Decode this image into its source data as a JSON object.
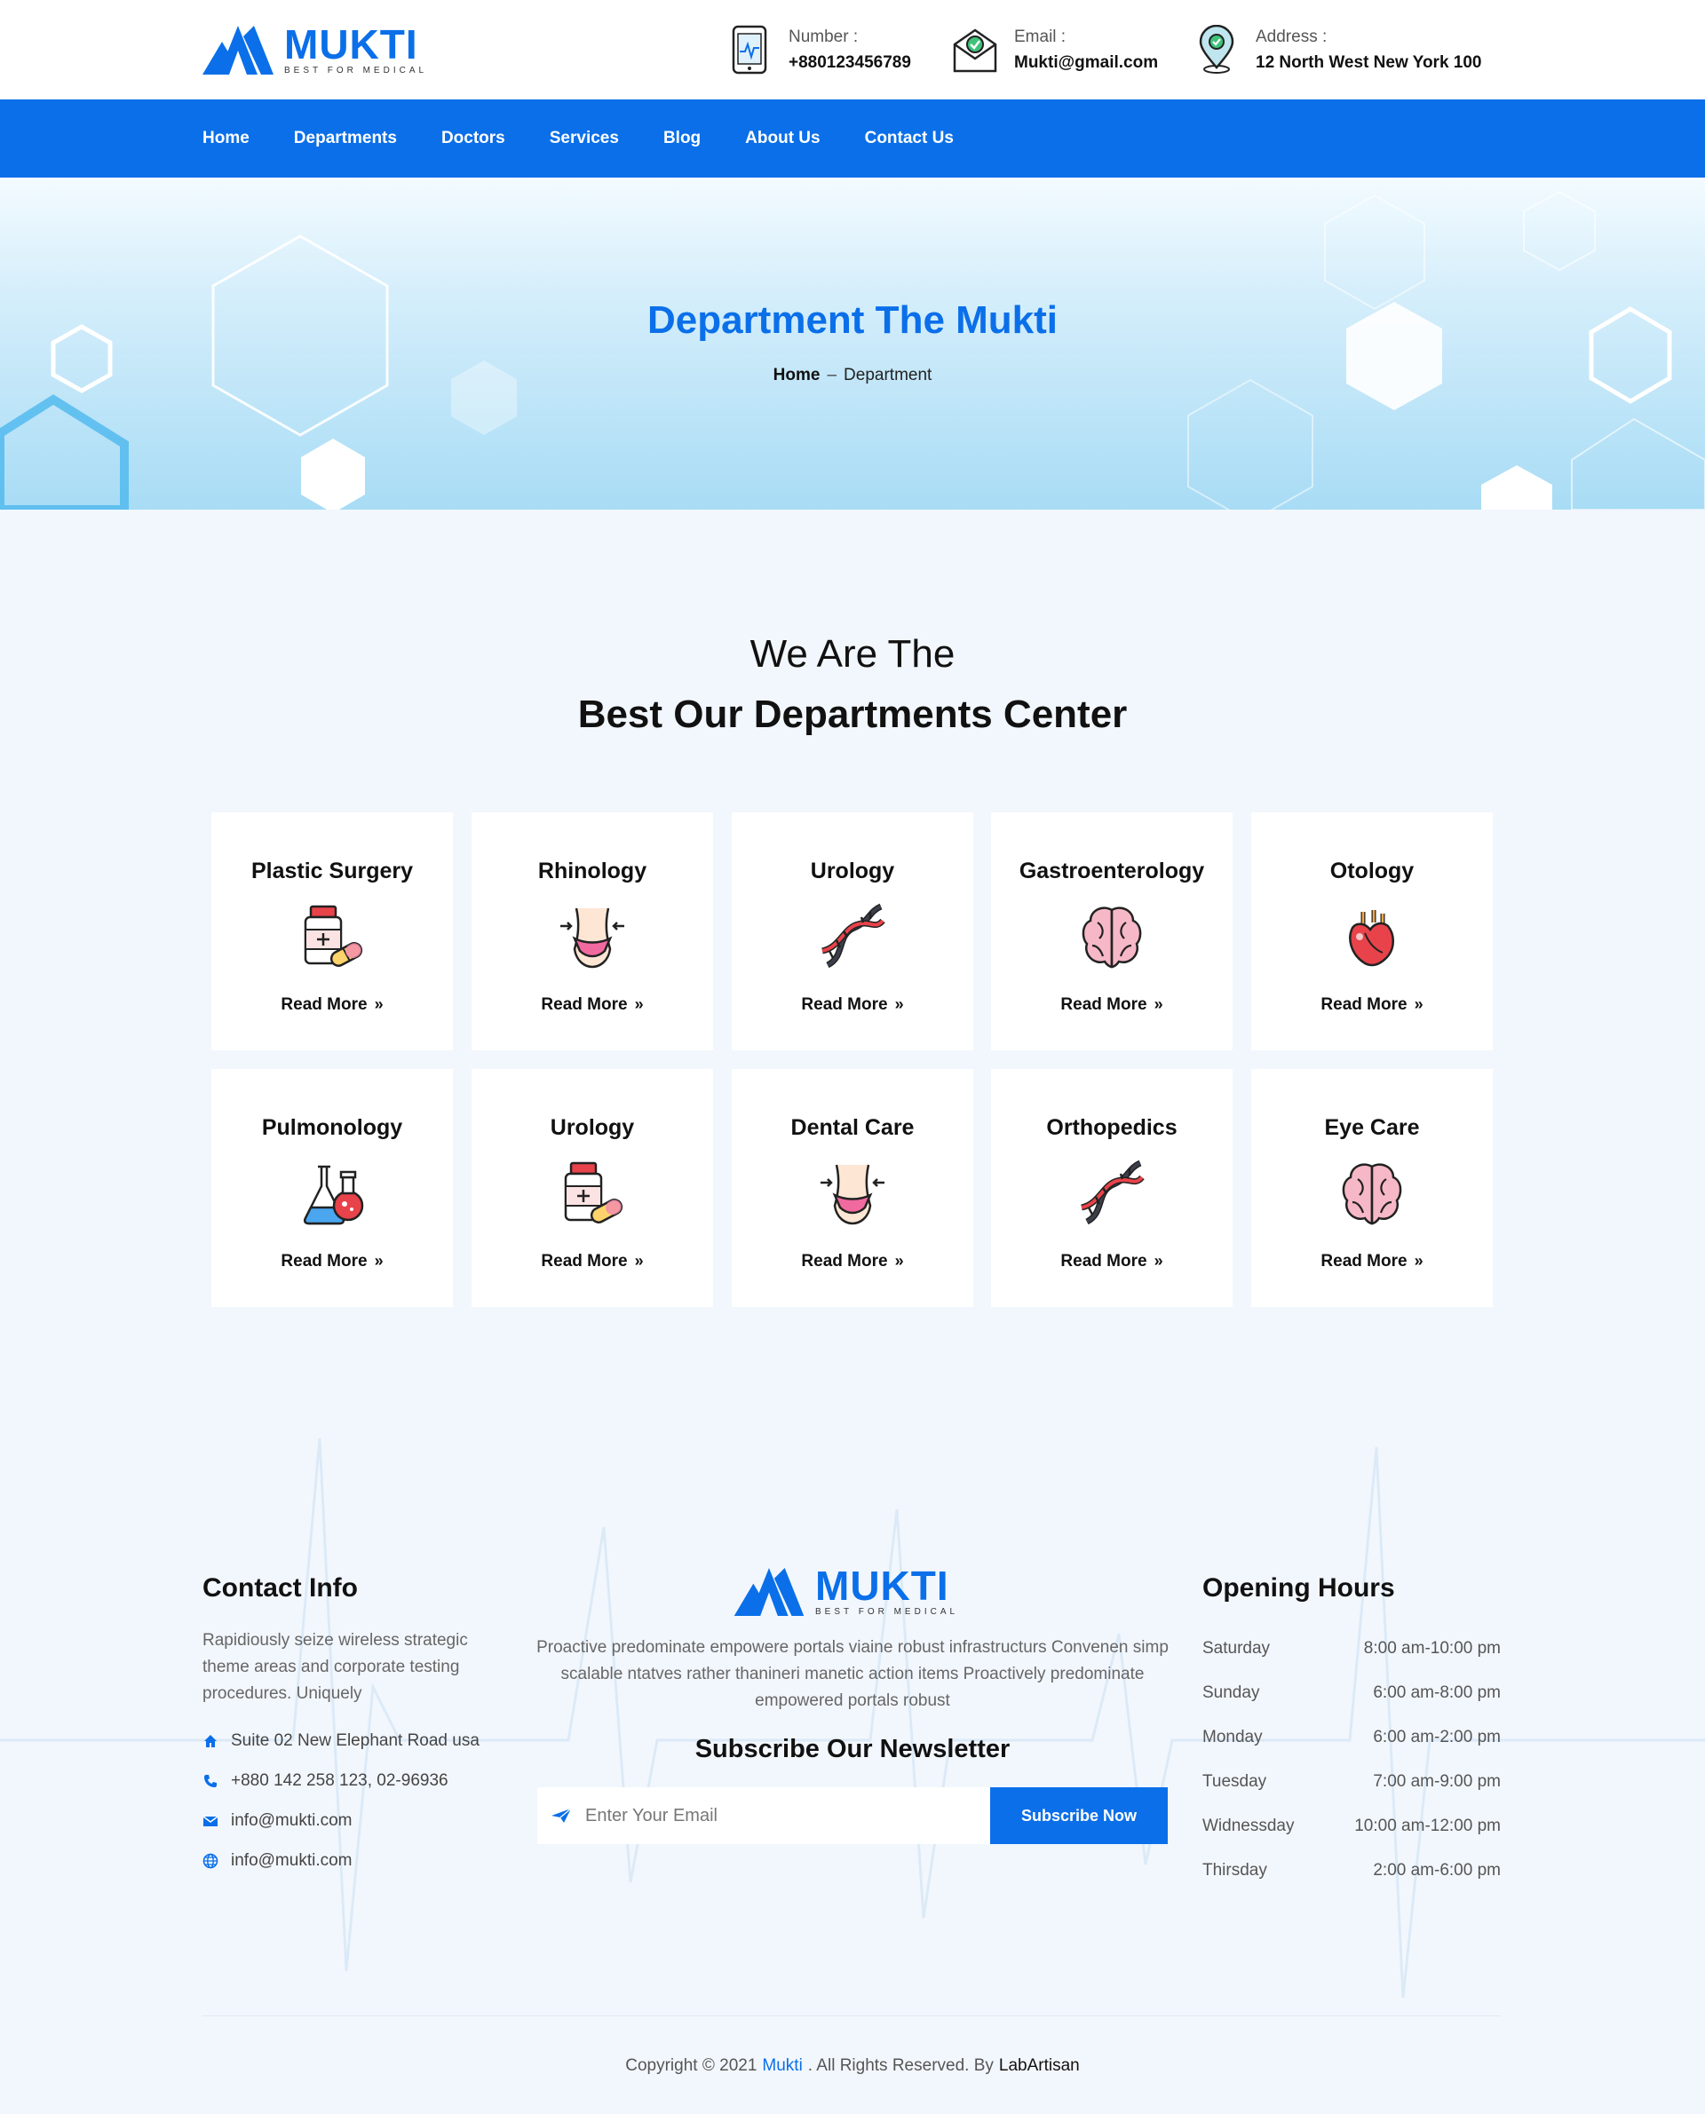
{
  "brand": {
    "name": "MUKTI",
    "tagline": "BEST FOR MEDICAL",
    "color": "#0a6fe8"
  },
  "header": {
    "contacts": [
      {
        "icon": "phone-chart-icon",
        "label": "Number :",
        "value": "+880123456789"
      },
      {
        "icon": "mail-check-icon",
        "label": "Email :",
        "value": "Mukti@gmail.com"
      },
      {
        "icon": "location-pin-icon",
        "label": "Address :",
        "value": "12 North West New York 100"
      }
    ]
  },
  "nav": {
    "items": [
      "Home",
      "Departments",
      "Doctors",
      "Services",
      "Blog",
      "About Us",
      "Contact Us"
    ]
  },
  "hero": {
    "title": "Department The Mukti",
    "crumb_home": "Home",
    "crumb_sep": "–",
    "crumb_current": "Department"
  },
  "section": {
    "subtitle": "We Are The",
    "title": "Best Our Departments Center"
  },
  "departments": [
    {
      "name": "Plastic Surgery",
      "icon": "medicine-bottle-icon",
      "link": "Read More"
    },
    {
      "name": "Rhinology",
      "icon": "body-waist-icon",
      "link": "Read More"
    },
    {
      "name": "Urology",
      "icon": "dna-icon",
      "link": "Read More"
    },
    {
      "name": "Gastroenterology",
      "icon": "brain-icon",
      "link": "Read More"
    },
    {
      "name": "Otology",
      "icon": "heart-organ-icon",
      "link": "Read More"
    },
    {
      "name": "Pulmonology",
      "icon": "lab-flasks-icon",
      "link": "Read More"
    },
    {
      "name": "Urology",
      "icon": "medicine-bottle-icon",
      "link": "Read More"
    },
    {
      "name": "Dental Care",
      "icon": "body-waist-icon",
      "link": "Read More"
    },
    {
      "name": "Orthopedics",
      "icon": "dna-icon",
      "link": "Read More"
    },
    {
      "name": "Eye Care",
      "icon": "brain-icon",
      "link": "Read More"
    }
  ],
  "footer": {
    "contact": {
      "title": "Contact Info",
      "text": "Rapidiously seize wireless strategic theme areas and corporate testing procedures. Uniquely",
      "items": [
        {
          "icon": "home-icon",
          "text": "Suite 02 New Elephant Road usa"
        },
        {
          "icon": "phone-icon",
          "text": "+880 142 258 123, 02-96936"
        },
        {
          "icon": "envelope-icon",
          "text": "info@mukti.com"
        },
        {
          "icon": "globe-icon",
          "text": "info@mukti.com"
        }
      ]
    },
    "about": "Proactive predominate empowere portals viaine robust infrastructurs Convenen simp scalable ntatves rather thanineri manetic action items Proactively predominate empowered portals robust",
    "newsletter": {
      "title": "Subscribe Our Newsletter",
      "placeholder": "Enter Your Email",
      "value": "",
      "button": "Subscribe Now"
    },
    "hours": {
      "title": "Opening Hours",
      "rows": [
        {
          "day": "Saturday",
          "time": "8:00 am-10:00 pm"
        },
        {
          "day": "Sunday",
          "time": "6:00 am-8:00 pm"
        },
        {
          "day": "Monday",
          "time": "6:00 am-2:00 pm"
        },
        {
          "day": "Tuesday",
          "time": "7:00 am-9:00 pm"
        },
        {
          "day": "Widnessday",
          "time": "10:00 am-12:00 pm"
        },
        {
          "day": "Thirsday",
          "time": "2:00 am-6:00 pm"
        }
      ]
    },
    "copyright": {
      "prefix": "Copyright © 2021",
      "brand": "Mukti",
      "middle": ". All Rights Reserved. By",
      "author": "LabArtisan"
    }
  }
}
